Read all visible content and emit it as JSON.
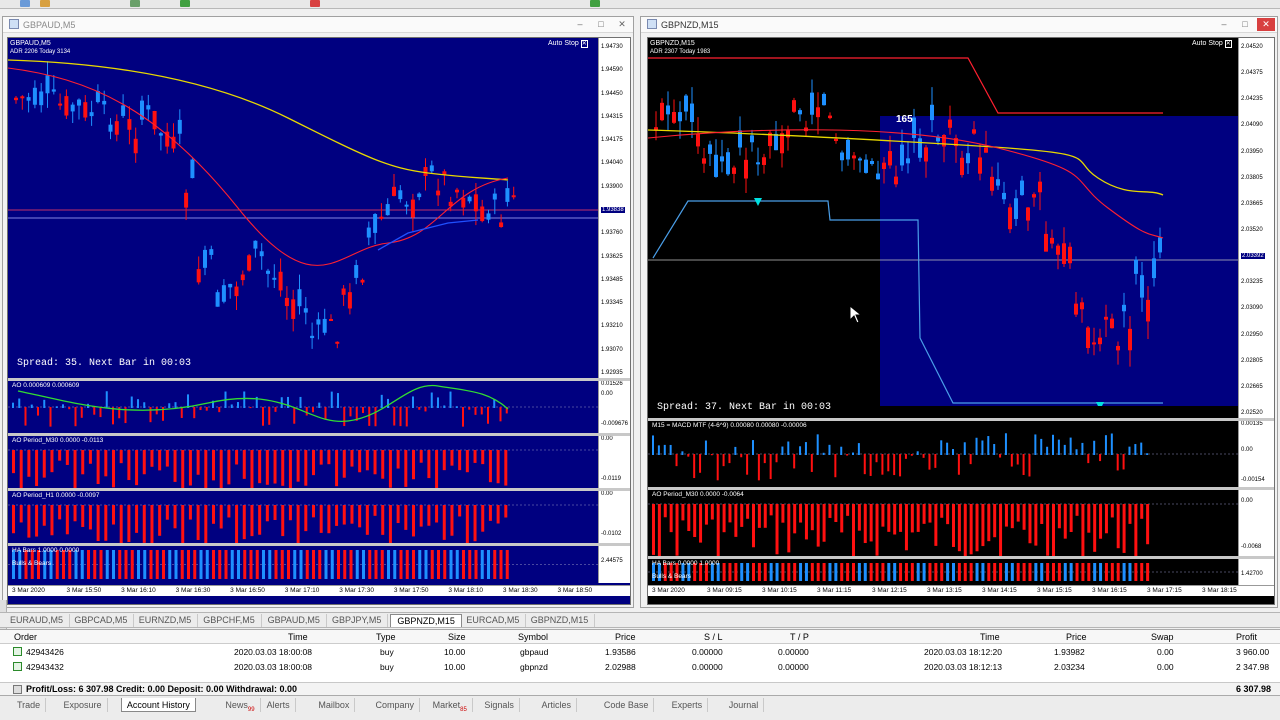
{
  "left_window": {
    "title": "GBPAUD,M5",
    "chart_symbol": "GBPAUD,M5",
    "chart_stat": "ADR 2206  Today 3134",
    "autostop": "Auto Stop",
    "spread_text": "Spread: 35. Next Bar in 00:03",
    "price_ticks": [
      "1.94730",
      "1.94590",
      "1.94450",
      "1.94315",
      "1.94175",
      "1.94040",
      "1.93900",
      "1.93838",
      "1.93760",
      "1.93625",
      "1.93485",
      "1.93345",
      "1.93210",
      "1.93070",
      "1.92935"
    ],
    "current_price": "1.93838",
    "time_labels": [
      "3 Mar 2020",
      "3 Mar 15:50",
      "3 Mar 16:10",
      "3 Mar 16:30",
      "3 Mar 16:50",
      "3 Mar 17:10",
      "3 Mar 17:30",
      "3 Mar 17:50",
      "3 Mar 18:10",
      "3 Mar 18:30",
      "3 Mar 18:50"
    ],
    "pane1_label": "AO 0.000609 0.000609",
    "pane1_ticks": [
      "0.01526",
      "0.00",
      "-0.009676"
    ],
    "pane2_label": "AO Period_M30 0.0000 -0.0113",
    "pane2_ticks": [
      "0.00",
      "-0.0119"
    ],
    "pane3_label": "AO Period_H1 0.0000 -0.0097",
    "pane3_ticks": [
      "0.00",
      "-0.0102"
    ],
    "pane4_label": "HA Bars 1.0000 0.0000",
    "pane4_sub": "Bulls & Bears",
    "pane4_ticks": [
      "2.44575"
    ]
  },
  "right_window": {
    "title": "GBPNZD,M15",
    "chart_symbol": "GBPNZD,M15",
    "chart_stat": "ADR 2307  Today 1983",
    "autostop": "Auto Stop",
    "box_label": "165",
    "spread_text": "Spread: 37. Next Bar in 00:03",
    "price_ticks": [
      "2.04520",
      "2.04375",
      "2.04235",
      "2.04090",
      "2.03950",
      "2.03805",
      "2.03665",
      "2.03520",
      "2.03392",
      "2.03235",
      "2.03090",
      "2.02950",
      "2.02805",
      "2.02665",
      "2.02520"
    ],
    "current_price": "2.03392",
    "time_labels": [
      "3 Mar 2020",
      "3 Mar 09:15",
      "3 Mar 10:15",
      "3 Mar 11:15",
      "3 Mar 12:15",
      "3 Mar 13:15",
      "3 Mar 14:15",
      "3 Mar 15:15",
      "3 Mar 16:15",
      "3 Mar 17:15",
      "3 Mar 18:15"
    ],
    "pane1_label": "M15 = MACD MTF (4-6^9) 0.00080 0.00080 -0.00006",
    "pane1_ticks": [
      "0.00135",
      "0.00",
      "-0.00154"
    ],
    "pane2_label": "AO Period_M30 0.0000 -0.0064",
    "pane2_ticks": [
      "0.00",
      "-0.0068"
    ],
    "pane3_label": "HA Bars 0.0000 1.0000",
    "pane3_sub": "Bulls & Bears",
    "pane3_ticks": [
      "1.42700"
    ]
  },
  "chart_tabs": [
    "EURAUD,M5",
    "GBPCAD,M5",
    "EURNZD,M5",
    "GBPCHF,M5",
    "GBPAUD,M5",
    "GBPJPY,M5",
    "GBPNZD,M15",
    "EURCAD,M5",
    "GBPNZD,M15"
  ],
  "active_chart_tab": "GBPNZD,M15",
  "terminal": {
    "headers": [
      "Order",
      "Time",
      "Type",
      "Size",
      "Symbol",
      "Price",
      "S / L",
      "T / P",
      "Time",
      "Price",
      "Swap",
      "Profit"
    ],
    "rows": [
      [
        "42943426",
        "2020.03.03 18:00:08",
        "buy",
        "10.00",
        "gbpaud",
        "1.93586",
        "0.00000",
        "0.00000",
        "2020.03.03 18:12:20",
        "1.93982",
        "0.00",
        "3 960.00"
      ],
      [
        "42943432",
        "2020.03.03 18:00:08",
        "buy",
        "10.00",
        "gbpnzd",
        "2.02988",
        "0.00000",
        "0.00000",
        "2020.03.03 18:12:13",
        "2.03234",
        "0.00",
        "2 347.98"
      ]
    ],
    "summary": "Profit/Loss: 6 307.98  Credit: 0.00  Deposit: 0.00  Withdrawal: 0.00",
    "summary_total": "6 307.98"
  },
  "bottom_tabs": [
    "Trade",
    "Exposure",
    "Account History",
    "News",
    "Alerts",
    "Mailbox",
    "Company",
    "Market",
    "Signals",
    "Articles",
    "Code Base",
    "Experts",
    "Journal"
  ],
  "news_badge": "99",
  "market_badge": "85",
  "active_bottom_tab": "Account History",
  "colors": {
    "chart_bg": "#000080",
    "bull": "#1e90ff",
    "bear": "#ff0000",
    "ma_yellow": "#e8d800",
    "ma_red": "#ff2030",
    "green": "#32dc32"
  }
}
